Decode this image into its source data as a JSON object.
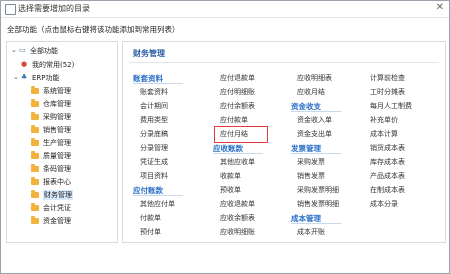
{
  "window": {
    "title": "选择需要增加的目录"
  },
  "hint": "全部功能（点击鼠标右键将该功能添加到常用列表）",
  "tree": {
    "root": "全部功能",
    "favorites": "我的常用(52)",
    "erp": "ERP功能",
    "modules": [
      "系统管理",
      "仓库管理",
      "采购管理",
      "销售管理",
      "生产管理",
      "质量管理",
      "条码管理",
      "报表中心",
      "财务管理",
      "会计凭证",
      "资金管理"
    ],
    "selected": "财务管理"
  },
  "panel": {
    "title": "财务管理",
    "col1": {
      "head1": "账套资料",
      "items1": [
        "账套资料",
        "会计期间",
        "费用类型",
        "分录底稿",
        "分录管理",
        "凭证生成",
        "项目资料"
      ],
      "head2": "应付账款",
      "items2": [
        "其他应付单",
        "付款单",
        "预付单"
      ]
    },
    "col2": {
      "items1": [
        "应付退款单",
        "应付明细账",
        "应付余额表",
        "应付款单",
        "应付月结"
      ],
      "head2": "应收账款",
      "items2": [
        "其他应收单",
        "收款单",
        "预收单",
        "应收退款单",
        "应收余额表",
        "应收明细账"
      ]
    },
    "col3": {
      "items1": [
        "应收明细表",
        "应收月结"
      ],
      "head2": "资金收支",
      "items2": [
        "资金收入单",
        "资金支出单"
      ],
      "head3": "发票管理",
      "items3": [
        "采购发票",
        "销售发票",
        "采购发票明细",
        "销售发票明细"
      ],
      "head4": "成本管理",
      "items4": [
        "成本开账"
      ]
    },
    "col4": {
      "items": [
        "计算前检查",
        "工时分摊表",
        "每月人工制费",
        "补充单价",
        "成本计算",
        "销货成本表",
        "库存成本表",
        "产品成本表",
        "在制成本表",
        "成本分录"
      ]
    },
    "highlighted": "应付月结"
  },
  "colors": {
    "accent": "#2a6fc9",
    "highlight": "#e23b3b",
    "folder": "#f2b33d"
  }
}
